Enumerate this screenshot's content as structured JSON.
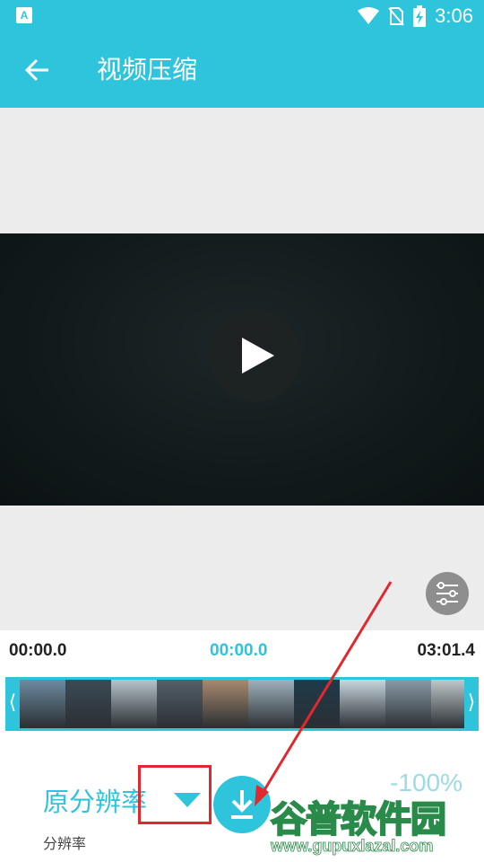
{
  "status_bar": {
    "app_icon_glyph": "A",
    "time": "3:06",
    "icons": [
      "wifi-icon",
      "no-sim-icon",
      "battery-charging-icon"
    ]
  },
  "app_bar": {
    "title": "视频压缩",
    "back_icon": "arrow-left-icon"
  },
  "video": {
    "play_icon": "play-icon",
    "adjust_icon": "sliders-icon"
  },
  "timeline": {
    "start_time": "00:00.0",
    "current_time": "00:00.0",
    "end_time": "03:01.4",
    "left_handle": "⟨",
    "right_handle": "⟩",
    "frame_colors": [
      "#6d8ba0",
      "#3c4a55",
      "#b7c3cb",
      "#55606a",
      "#a88a6f",
      "#9fb2bd",
      "#1f3a4a",
      "#c9d6de",
      "#8a9aa6",
      "#c0c8cc"
    ]
  },
  "controls": {
    "resolution_value": "原分辨率",
    "resolution_caption": "分辨率",
    "percent_value": "-100%",
    "download_icon": "download-icon",
    "dropdown_icon": "triangle-down-icon"
  },
  "watermark": {
    "name": "谷普软件园",
    "url": "www.gupuxlazal.com"
  },
  "colors": {
    "accent": "#2ec4dc",
    "annotation": "#e0282e"
  }
}
